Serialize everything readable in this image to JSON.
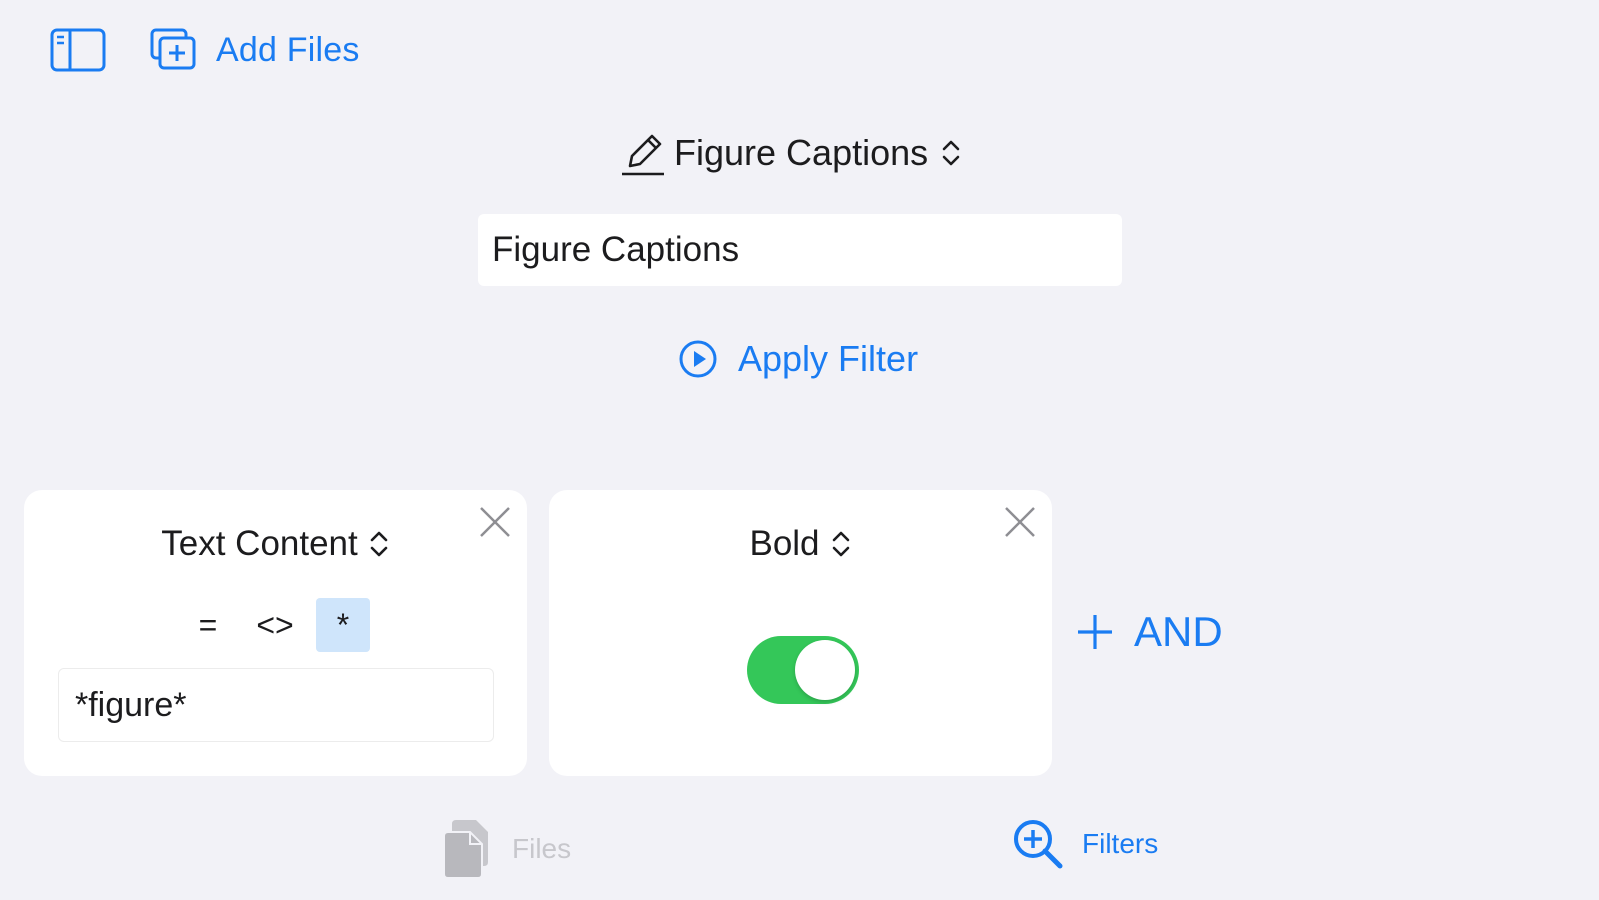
{
  "toolbar": {
    "sidebar_icon": "sidebar-icon",
    "add_files_icon": "add-files-icon",
    "add_files_label": "Add Files"
  },
  "filter": {
    "name_menu_icon": "pencil-icon",
    "name_menu_label": "Figure Captions",
    "name_field_value": "Figure Captions",
    "apply_icon": "play-circle-icon",
    "apply_label": "Apply Filter"
  },
  "conditions": [
    {
      "field": "Text Content",
      "operators": [
        "=",
        "<>",
        "*"
      ],
      "selected_operator": "*",
      "value": "*figure*"
    },
    {
      "field": "Bold",
      "toggle_on": true
    }
  ],
  "and_button": {
    "icon": "plus-icon",
    "label": "AND"
  },
  "tabbar": {
    "tabs": [
      {
        "label": "Files",
        "icon": "documents-icon",
        "active": false
      },
      {
        "label": "Filters",
        "icon": "magnify-plus-icon",
        "active": true
      }
    ]
  },
  "colors": {
    "accent": "#1a7cf2",
    "background": "#f2f2f7",
    "card": "#ffffff",
    "toggle_on": "#34c759",
    "selected_operator_bg": "#cfe5fb",
    "inactive_tab": "#c7c7cc"
  }
}
